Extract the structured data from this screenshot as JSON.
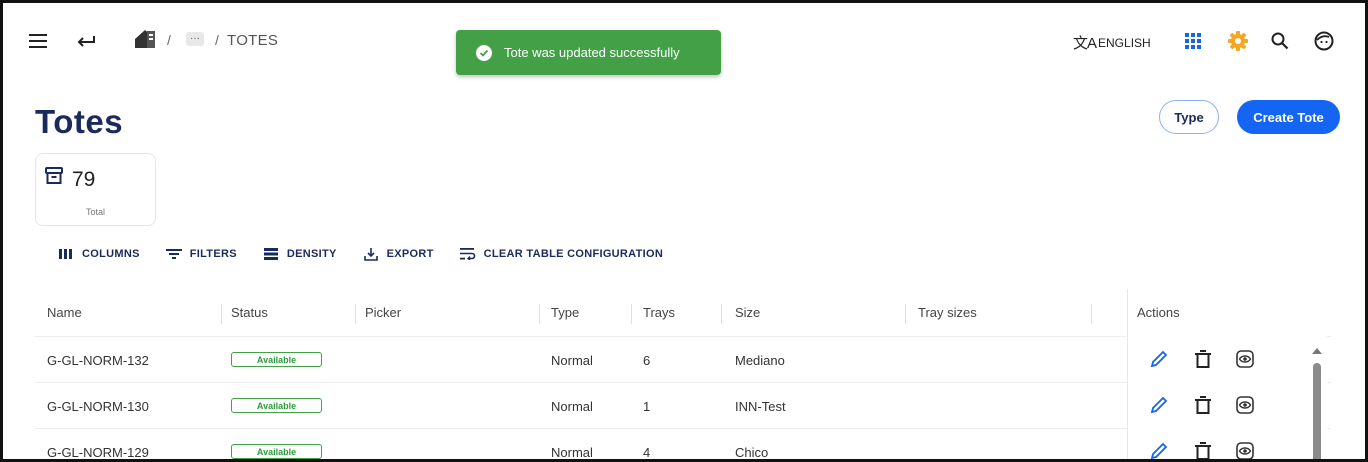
{
  "breadcrumb": {
    "separator": "/",
    "ellipsis": "···",
    "current": "TOTES"
  },
  "toast": {
    "message": "Tote was updated successfully",
    "color": "#43a047"
  },
  "header": {
    "language": "ENGLISH",
    "language_glyph": "文A"
  },
  "page": {
    "title": "Totes",
    "type_button": "Type",
    "create_button": "Create Tote"
  },
  "stats": {
    "count": "79",
    "label": "Total"
  },
  "toolbar": {
    "columns": "COLUMNS",
    "filters": "FILTERS",
    "density": "DENSITY",
    "export": "EXPORT",
    "clear": "CLEAR TABLE CONFIGURATION"
  },
  "table": {
    "headers": {
      "name": "Name",
      "status": "Status",
      "picker": "Picker",
      "type": "Type",
      "trays": "Trays",
      "size": "Size",
      "tray_sizes": "Tray sizes",
      "actions": "Actions"
    },
    "rows": [
      {
        "name": "G-GL-NORM-132",
        "status": "Available",
        "picker": "",
        "type": "Normal",
        "trays": "6",
        "size": "Mediano",
        "tray_sizes": ""
      },
      {
        "name": "G-GL-NORM-130",
        "status": "Available",
        "picker": "",
        "type": "Normal",
        "trays": "1",
        "size": "INN-Test",
        "tray_sizes": ""
      },
      {
        "name": "G-GL-NORM-129",
        "status": "Available",
        "picker": "",
        "type": "Normal",
        "trays": "4",
        "size": "Chico",
        "tray_sizes": ""
      }
    ]
  },
  "colors": {
    "primary": "#1565f5",
    "title": "#1a2a5c",
    "accent_gear": "#f5a623",
    "success": "#43a047"
  },
  "icons": [
    "menu-icon",
    "back-icon",
    "home-icon",
    "check-circle-icon",
    "translate-icon",
    "apps-icon",
    "gear-icon",
    "search-icon",
    "account-icon",
    "archive-box-icon",
    "columns-icon",
    "filter-icon",
    "density-icon",
    "export-icon",
    "clear-config-icon",
    "edit-icon",
    "delete-icon",
    "view-icon"
  ]
}
